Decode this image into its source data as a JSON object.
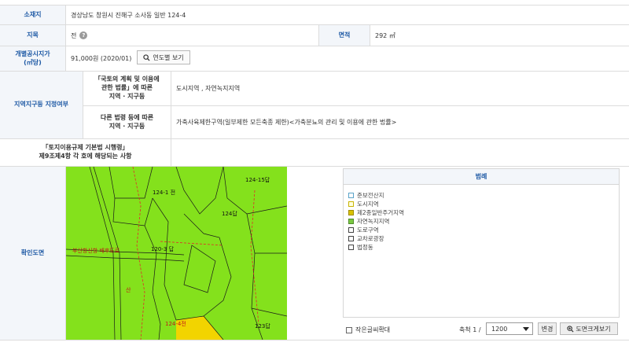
{
  "rows": {
    "location": {
      "label": "소재지",
      "value": "경상남도 창원시 진해구 소사동 일반 124-4"
    },
    "jimok": {
      "label": "지목",
      "value": "전",
      "help": "?",
      "area_label": "면적",
      "area_value": "292 ㎡"
    },
    "price": {
      "label": "개별공시지가\n(㎡당)",
      "value": "91,000원 (2020/01)",
      "button": "연도별 보기"
    },
    "zone": {
      "label": "지역지구등 지정여부",
      "sub1_label": "「국토의 계획 및 이용에\n관한 법률」에 따른\n지역 · 지구등",
      "sub1_value": "도시지역 , 자연녹지지역",
      "sub2_label": "다른 법령 등에 따른\n지역 · 지구등",
      "sub2_value": "가축사육제한구역(일부제한 모든축종 제한)<가축분뇨의 관리 및 이용에 관한 법률>"
    },
    "regulation": {
      "label": "「토지이용규제 기본법 시행령」\n제9조제4항 각 호에 해당되는 사항",
      "value": ""
    },
    "map": {
      "label": "확인도면"
    }
  },
  "map_labels": [
    "124-1 전",
    "124-15답",
    "124답",
    "부산항신항 배후도로",
    "120-3 답",
    "산",
    "123답",
    "124-4전"
  ],
  "legend": {
    "title": "범례",
    "items": [
      {
        "label": "준보전산지",
        "color": "#ffffff",
        "border": "#5aa3c8"
      },
      {
        "label": "도시지역",
        "color": "#ffffe0",
        "border": "#c8b400"
      },
      {
        "label": "제2종일반주거지역",
        "color": "#d9c200",
        "border": "#a08c00"
      },
      {
        "label": "자연녹지지역",
        "color": "#7ac943",
        "border": "#4f8c2a"
      },
      {
        "label": "도로구역",
        "color": "#ffffff",
        "border": "#444444"
      },
      {
        "label": "교차로광장",
        "color": "#ffffff",
        "border": "#444444"
      },
      {
        "label": "법정동",
        "color": "#ffffff",
        "border": "#444444"
      }
    ]
  },
  "controls": {
    "enlarge_label": "작은글씨확대",
    "scale_label": "축척 1 /",
    "scale_value": "1200",
    "change_button": "변경",
    "print_button": "도면크게보기"
  }
}
